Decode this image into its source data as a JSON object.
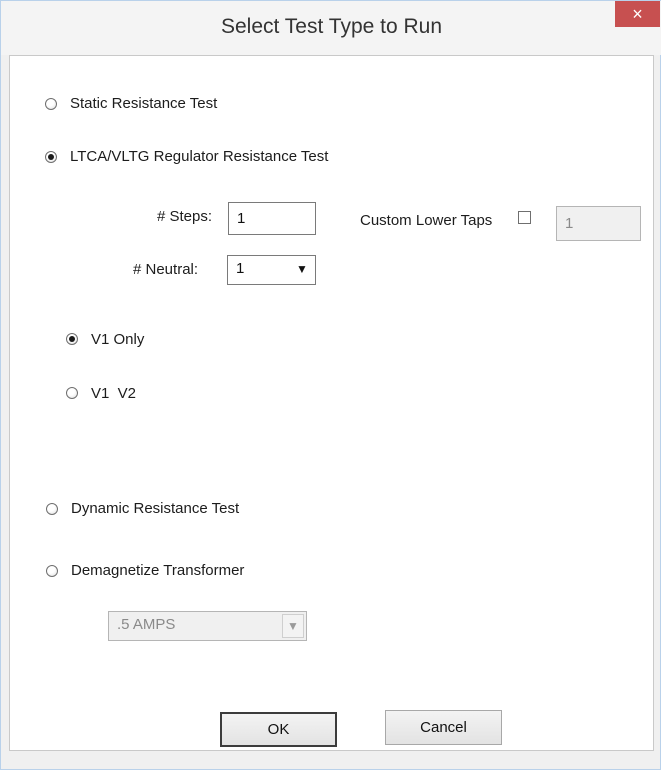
{
  "window": {
    "title": "Select Test Type to Run",
    "close_glyph": "×"
  },
  "options": {
    "static": "Static Resistance Test",
    "ltca": "LTCA/VLTG Regulator Resistance Test",
    "dynamic": "Dynamic Resistance Test",
    "demag": "Demagnetize Transformer"
  },
  "ltca": {
    "steps_label": "# Steps:",
    "steps_value": "1",
    "neutral_label": "# Neutral:",
    "neutral_value": "1",
    "custom_lower_taps_label": "Custom Lower Taps",
    "custom_lower_taps_value": "1",
    "v1_only": "V1 Only",
    "v1_v2": "V1  V2"
  },
  "demag": {
    "amps_value": ".5 AMPS"
  },
  "buttons": {
    "ok": "OK",
    "cancel": "Cancel"
  },
  "state": {
    "selected_test": "ltca",
    "selected_voltage": "v1_only",
    "custom_lower_taps_checked": false
  }
}
